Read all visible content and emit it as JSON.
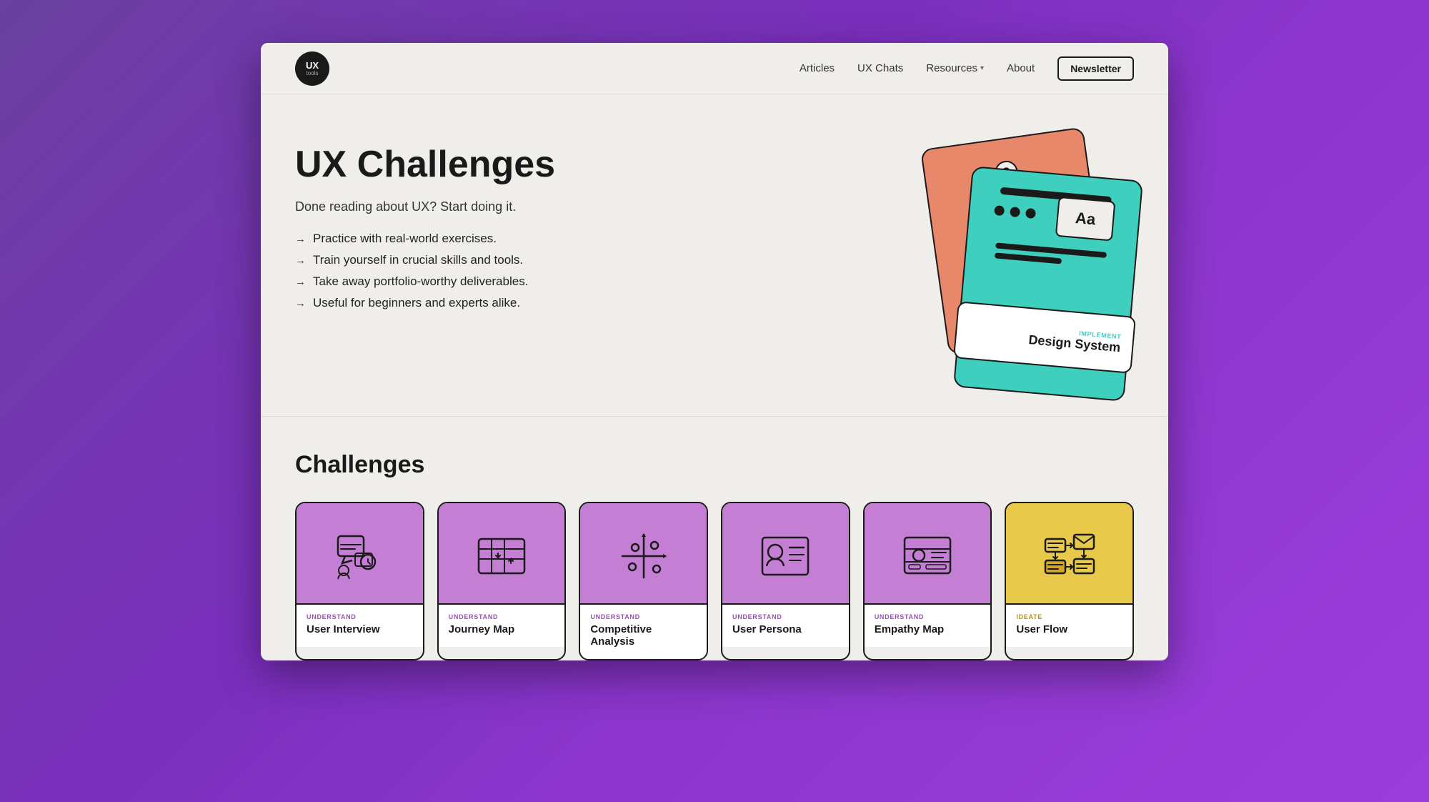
{
  "nav": {
    "logo_top": "UX",
    "logo_bottom": "tools",
    "links": [
      {
        "label": "Articles",
        "has_dropdown": false
      },
      {
        "label": "UX Chats",
        "has_dropdown": false
      },
      {
        "label": "Resources",
        "has_dropdown": true
      },
      {
        "label": "About",
        "has_dropdown": false
      }
    ],
    "newsletter_button": "Newsletter"
  },
  "hero": {
    "title": "UX Challenges",
    "subtitle": "Done reading about UX? Start doing it.",
    "bullets": [
      "Practice with real-world exercises.",
      "Train yourself in crucial skills and tools.",
      "Take away portfolio-worthy deliverables.",
      "Useful for beginners and experts alike."
    ],
    "card_front_label_tag": "IMPLEMENT",
    "card_front_label_title": "Design System",
    "card_aa_text": "Aa"
  },
  "challenges": {
    "section_title": "Challenges",
    "cards": [
      {
        "category": "UNDERSTAND",
        "name": "User Interview",
        "color": "purple",
        "icon_type": "user-interview"
      },
      {
        "category": "UNDERSTAND",
        "name": "Journey Map",
        "color": "purple",
        "icon_type": "journey-map"
      },
      {
        "category": "UNDERSTAND",
        "name": "Competitive Analysis",
        "color": "purple",
        "icon_type": "competitive-analysis"
      },
      {
        "category": "UNDERSTAND",
        "name": "User Persona",
        "color": "purple",
        "icon_type": "user-persona"
      },
      {
        "category": "UNDERSTAND",
        "name": "Empathy Map",
        "color": "purple",
        "icon_type": "empathy-map"
      },
      {
        "category": "IDEATE",
        "name": "User Flow",
        "color": "yellow",
        "icon_type": "user-flow"
      }
    ]
  }
}
